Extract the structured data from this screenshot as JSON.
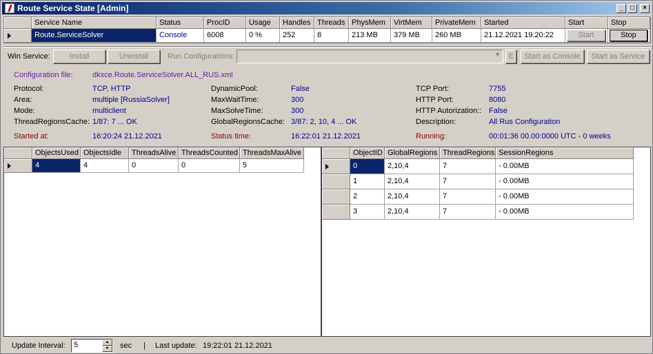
{
  "window": {
    "title": "Route Service State [Admin]"
  },
  "services": {
    "columns": [
      "Service Name",
      "Status",
      "ProcID",
      "Usage",
      "Handles",
      "Threads",
      "PhysMem",
      "VirtMem",
      "PrivateMem",
      "Started",
      "Start",
      "Stop"
    ],
    "row": {
      "name": "Route.ServiceSolver",
      "status": "Console",
      "procid": "6008",
      "usage": "0 %",
      "handles": "252",
      "threads": "8",
      "physmem": "213 MB",
      "virtmem": "379 MB",
      "privatemem": "260 MB",
      "started": "21.12.2021 19:20:22",
      "start_label": "Start",
      "stop_label": "Stop"
    }
  },
  "winservice": {
    "label": "Win Service:",
    "install": "Install",
    "uninstall": "Uninstall",
    "run_configs_label": "Run Configurations:",
    "run_configs_value": "",
    "e_button": "E",
    "start_console": "Start as Console",
    "start_service": "Start as Service"
  },
  "info": {
    "config_label": "Configuration file:",
    "config_value": "dkxce.Route.ServiceSolver.ALL_RUS.xml",
    "protocol_label": "Protocol:",
    "protocol_value": "TCP, HTTP",
    "area_label": "Area:",
    "area_value": "multiple [RussiaSolver]",
    "mode_label": "Mode:",
    "mode_value": "multiclient",
    "trc_label": "ThreadRegionsCache:",
    "trc_value": "1/87: 7 ... OK",
    "started_label": "Started at:",
    "started_value": "16:20:24 21.12.2021",
    "dynpool_label": "DynamicPool:",
    "dynpool_value": "False",
    "maxwait_label": "MaxWaitTime:",
    "maxwait_value": "300",
    "maxsolve_label": "MaxSolveTime:",
    "maxsolve_value": "300",
    "grc_label": "GlobalRegionsCache:",
    "grc_value": "3/87: 2, 10, 4 ... OK",
    "status_label": "Status time:",
    "status_value": "16:22:01 21.12.2021",
    "tcp_label": "TCP Port:",
    "tcp_value": "7755",
    "http_label": "HTTP Port:",
    "http_value": "8080",
    "auth_label": "HTTP Autorization::",
    "auth_value": "False",
    "desc_label": "Description:",
    "desc_value": "All Rus Configuration",
    "running_label": "Running:",
    "running_value": "00:01:36 00.00:0000 UTC - 0 weeks"
  },
  "objects": {
    "columns": [
      "ObjectsUsed",
      "ObjectsIdle",
      "ThreadsAlive",
      "ThreadsCounted",
      "ThreadsMaxAlive"
    ],
    "rows": [
      [
        "4",
        "4",
        "0",
        "0",
        "5"
      ]
    ]
  },
  "regions": {
    "columns": [
      "ObjectID",
      "GlobalRegions",
      "ThreadRegions",
      "SessionRegions"
    ],
    "rows": [
      [
        "0",
        "2,10,4",
        "7",
        "- 0.00MB"
      ],
      [
        "1",
        "2,10,4",
        "7",
        "- 0.00MB"
      ],
      [
        "2",
        "2,10,4",
        "7",
        "- 0.00MB"
      ],
      [
        "3",
        "2,10,4",
        "7",
        "- 0.00MB"
      ]
    ]
  },
  "footer": {
    "interval_label": "Update Interval:",
    "interval_value": "5",
    "unit": "sec",
    "sep": "|",
    "last_label": "Last update:",
    "last_value": "19:22:01 21.12.2021"
  }
}
